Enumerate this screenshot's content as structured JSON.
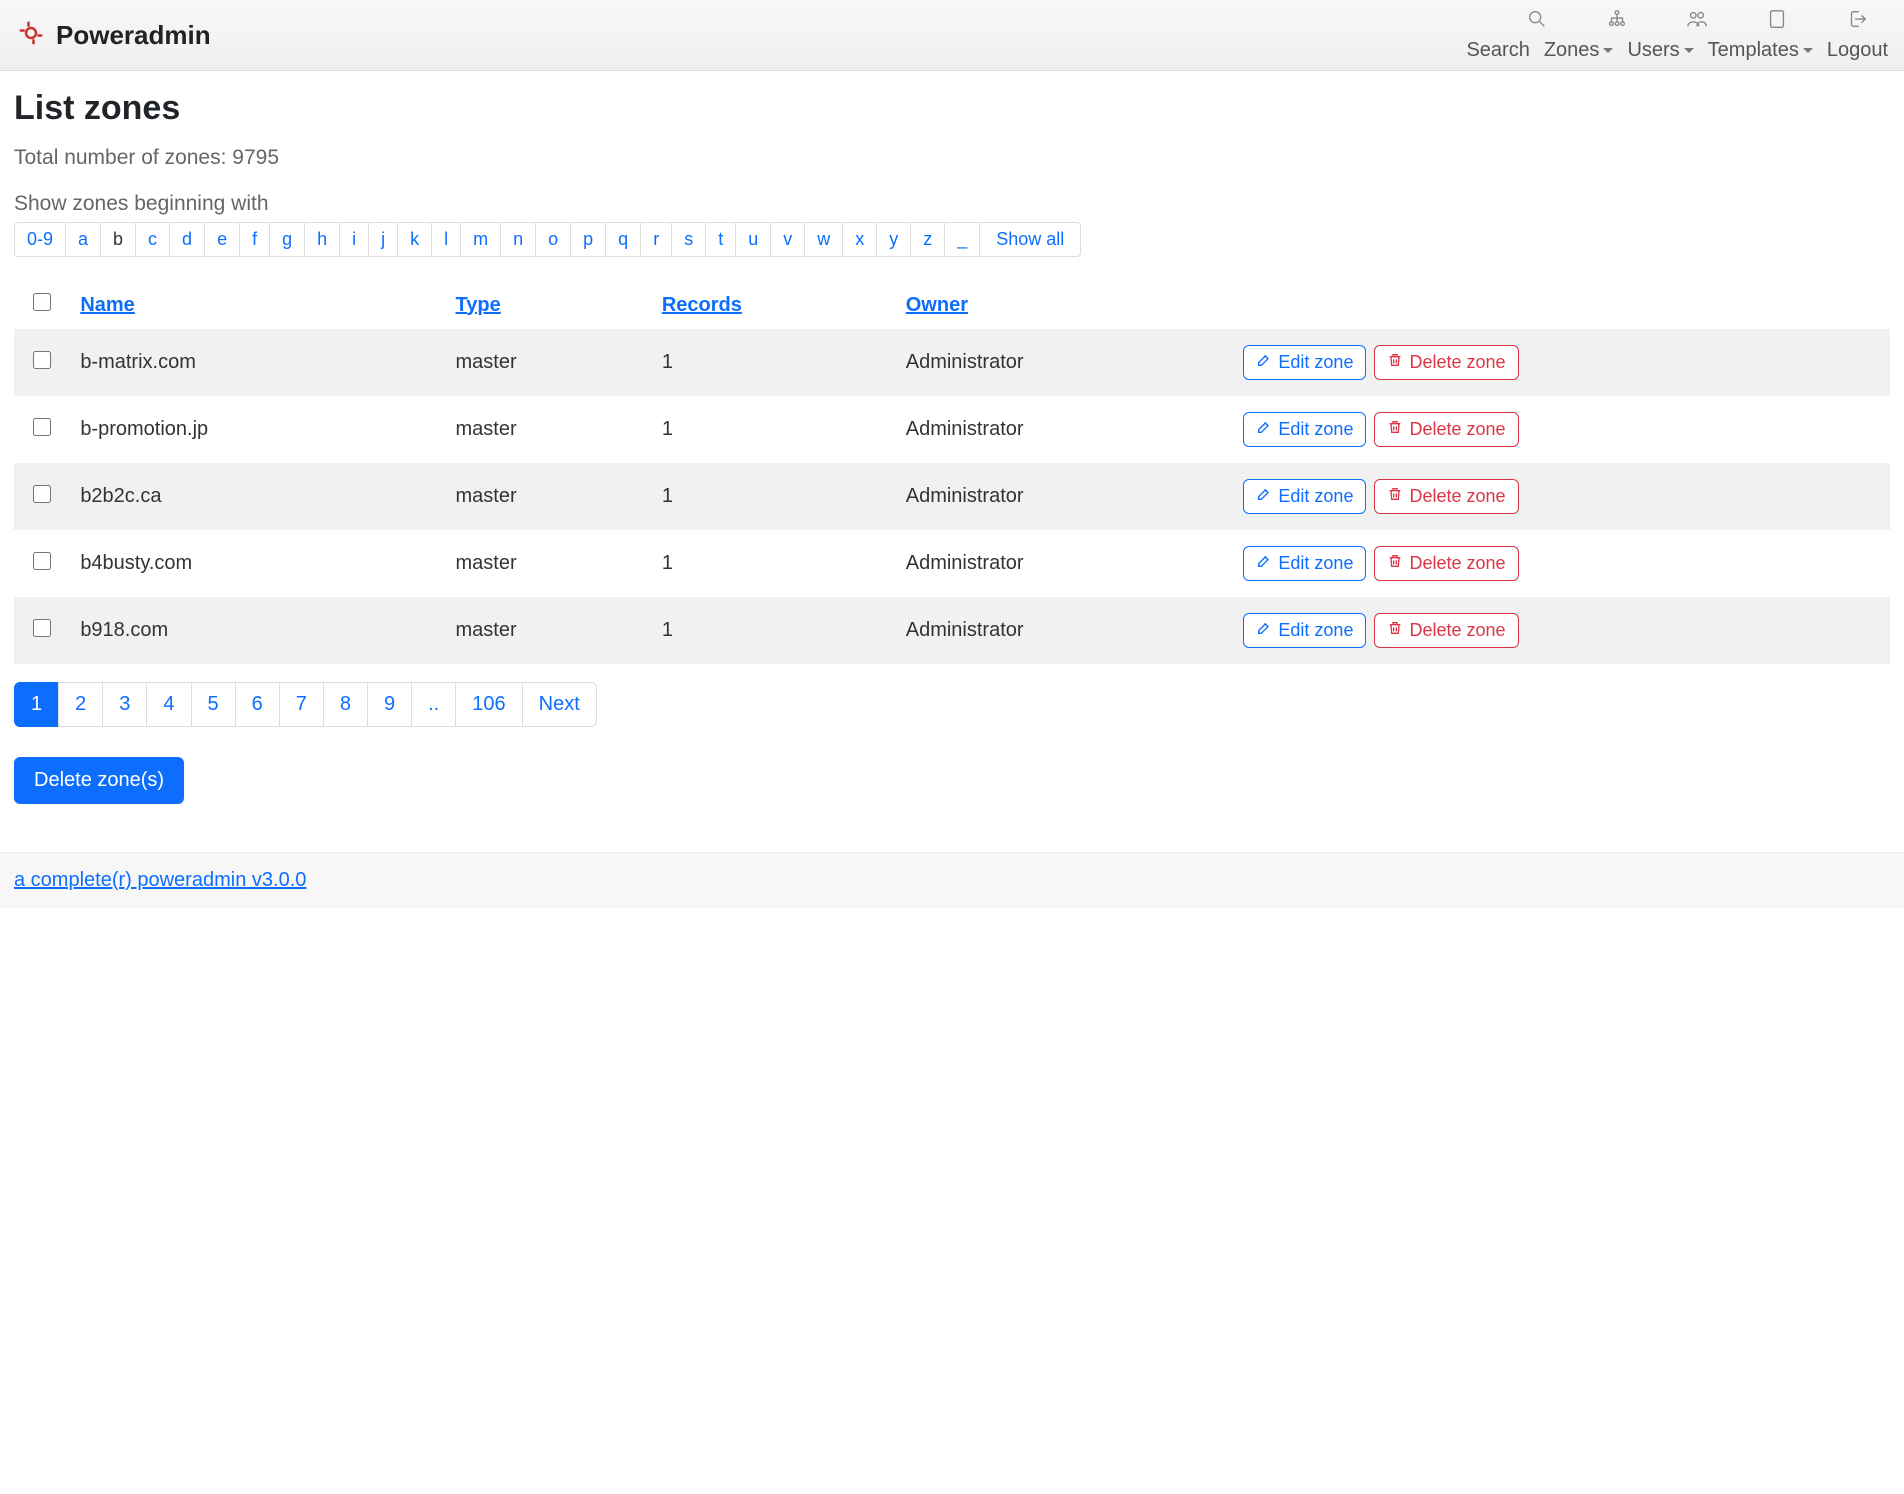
{
  "brand": "Poweradmin",
  "nav": {
    "search": "Search",
    "zones": "Zones",
    "users": "Users",
    "templates": "Templates",
    "logout": "Logout"
  },
  "page": {
    "title": "List zones",
    "total_label": "Total number of zones: 9795",
    "filter_label": "Show zones beginning with"
  },
  "letters": {
    "items": [
      "0-9",
      "a",
      "b",
      "c",
      "d",
      "e",
      "f",
      "g",
      "h",
      "i",
      "j",
      "k",
      "l",
      "m",
      "n",
      "o",
      "p",
      "q",
      "r",
      "s",
      "t",
      "u",
      "v",
      "w",
      "x",
      "y",
      "z",
      "_"
    ],
    "active": "b",
    "show_all": "Show all"
  },
  "table": {
    "headers": {
      "name": "Name",
      "type": "Type",
      "records": "Records",
      "owner": "Owner"
    },
    "rows": [
      {
        "name": "b-matrix.com",
        "type": "master",
        "records": "1",
        "owner": "Administrator"
      },
      {
        "name": "b-promotion.jp",
        "type": "master",
        "records": "1",
        "owner": "Administrator"
      },
      {
        "name": "b2b2c.ca",
        "type": "master",
        "records": "1",
        "owner": "Administrator"
      },
      {
        "name": "b4busty.com",
        "type": "master",
        "records": "1",
        "owner": "Administrator"
      },
      {
        "name": "b918.com",
        "type": "master",
        "records": "1",
        "owner": "Administrator"
      }
    ],
    "edit_label": "Edit zone",
    "delete_label": "Delete zone"
  },
  "pagination": {
    "pages": [
      "1",
      "2",
      "3",
      "4",
      "5",
      "6",
      "7",
      "8",
      "9",
      "..",
      "106",
      "Next"
    ],
    "active": "1"
  },
  "bulk_delete": "Delete zone(s)",
  "footer": {
    "link_text": "a complete(r) poweradmin",
    "version": " v3.0.0"
  }
}
